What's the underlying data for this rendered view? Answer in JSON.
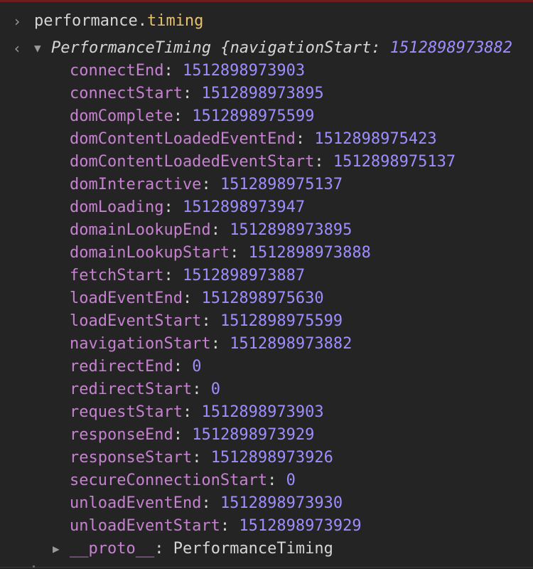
{
  "console": {
    "input": {
      "prompt_icon": "chevron-right-icon",
      "object": "performance",
      "dot": ".",
      "property": "timing"
    },
    "output": {
      "return_icon": "chevron-left-icon",
      "expand_icon": "triangle-down-icon",
      "summary_class": "PerformanceTiming",
      "summary_open": " {",
      "summary_key": "navigationStart",
      "summary_colon": ": ",
      "summary_value": "1512898973882"
    },
    "properties": [
      {
        "key": "connectEnd",
        "value": "1512898973903"
      },
      {
        "key": "connectStart",
        "value": "1512898973895"
      },
      {
        "key": "domComplete",
        "value": "1512898975599"
      },
      {
        "key": "domContentLoadedEventEnd",
        "value": "1512898975423"
      },
      {
        "key": "domContentLoadedEventStart",
        "value": "1512898975137"
      },
      {
        "key": "domInteractive",
        "value": "1512898975137"
      },
      {
        "key": "domLoading",
        "value": "1512898973947"
      },
      {
        "key": "domainLookupEnd",
        "value": "1512898973895"
      },
      {
        "key": "domainLookupStart",
        "value": "1512898973888"
      },
      {
        "key": "fetchStart",
        "value": "1512898973887"
      },
      {
        "key": "loadEventEnd",
        "value": "1512898975630"
      },
      {
        "key": "loadEventStart",
        "value": "1512898975599"
      },
      {
        "key": "navigationStart",
        "value": "1512898973882"
      },
      {
        "key": "redirectEnd",
        "value": "0"
      },
      {
        "key": "redirectStart",
        "value": "0"
      },
      {
        "key": "requestStart",
        "value": "1512898973903"
      },
      {
        "key": "responseEnd",
        "value": "1512898973929"
      },
      {
        "key": "responseStart",
        "value": "1512898973926"
      },
      {
        "key": "secureConnectionStart",
        "value": "0"
      },
      {
        "key": "unloadEventEnd",
        "value": "1512898973930"
      },
      {
        "key": "unloadEventStart",
        "value": "1512898973929"
      }
    ],
    "proto": {
      "expand_icon": "triangle-right-icon",
      "key": "__proto__",
      "colon": ": ",
      "value": "PerformanceTiming"
    },
    "colors": {
      "background": "#242424",
      "key": "#c781d1",
      "number": "#9d8ffb",
      "accent_property": "#e6c26e",
      "text": "#d5d5d5"
    }
  }
}
